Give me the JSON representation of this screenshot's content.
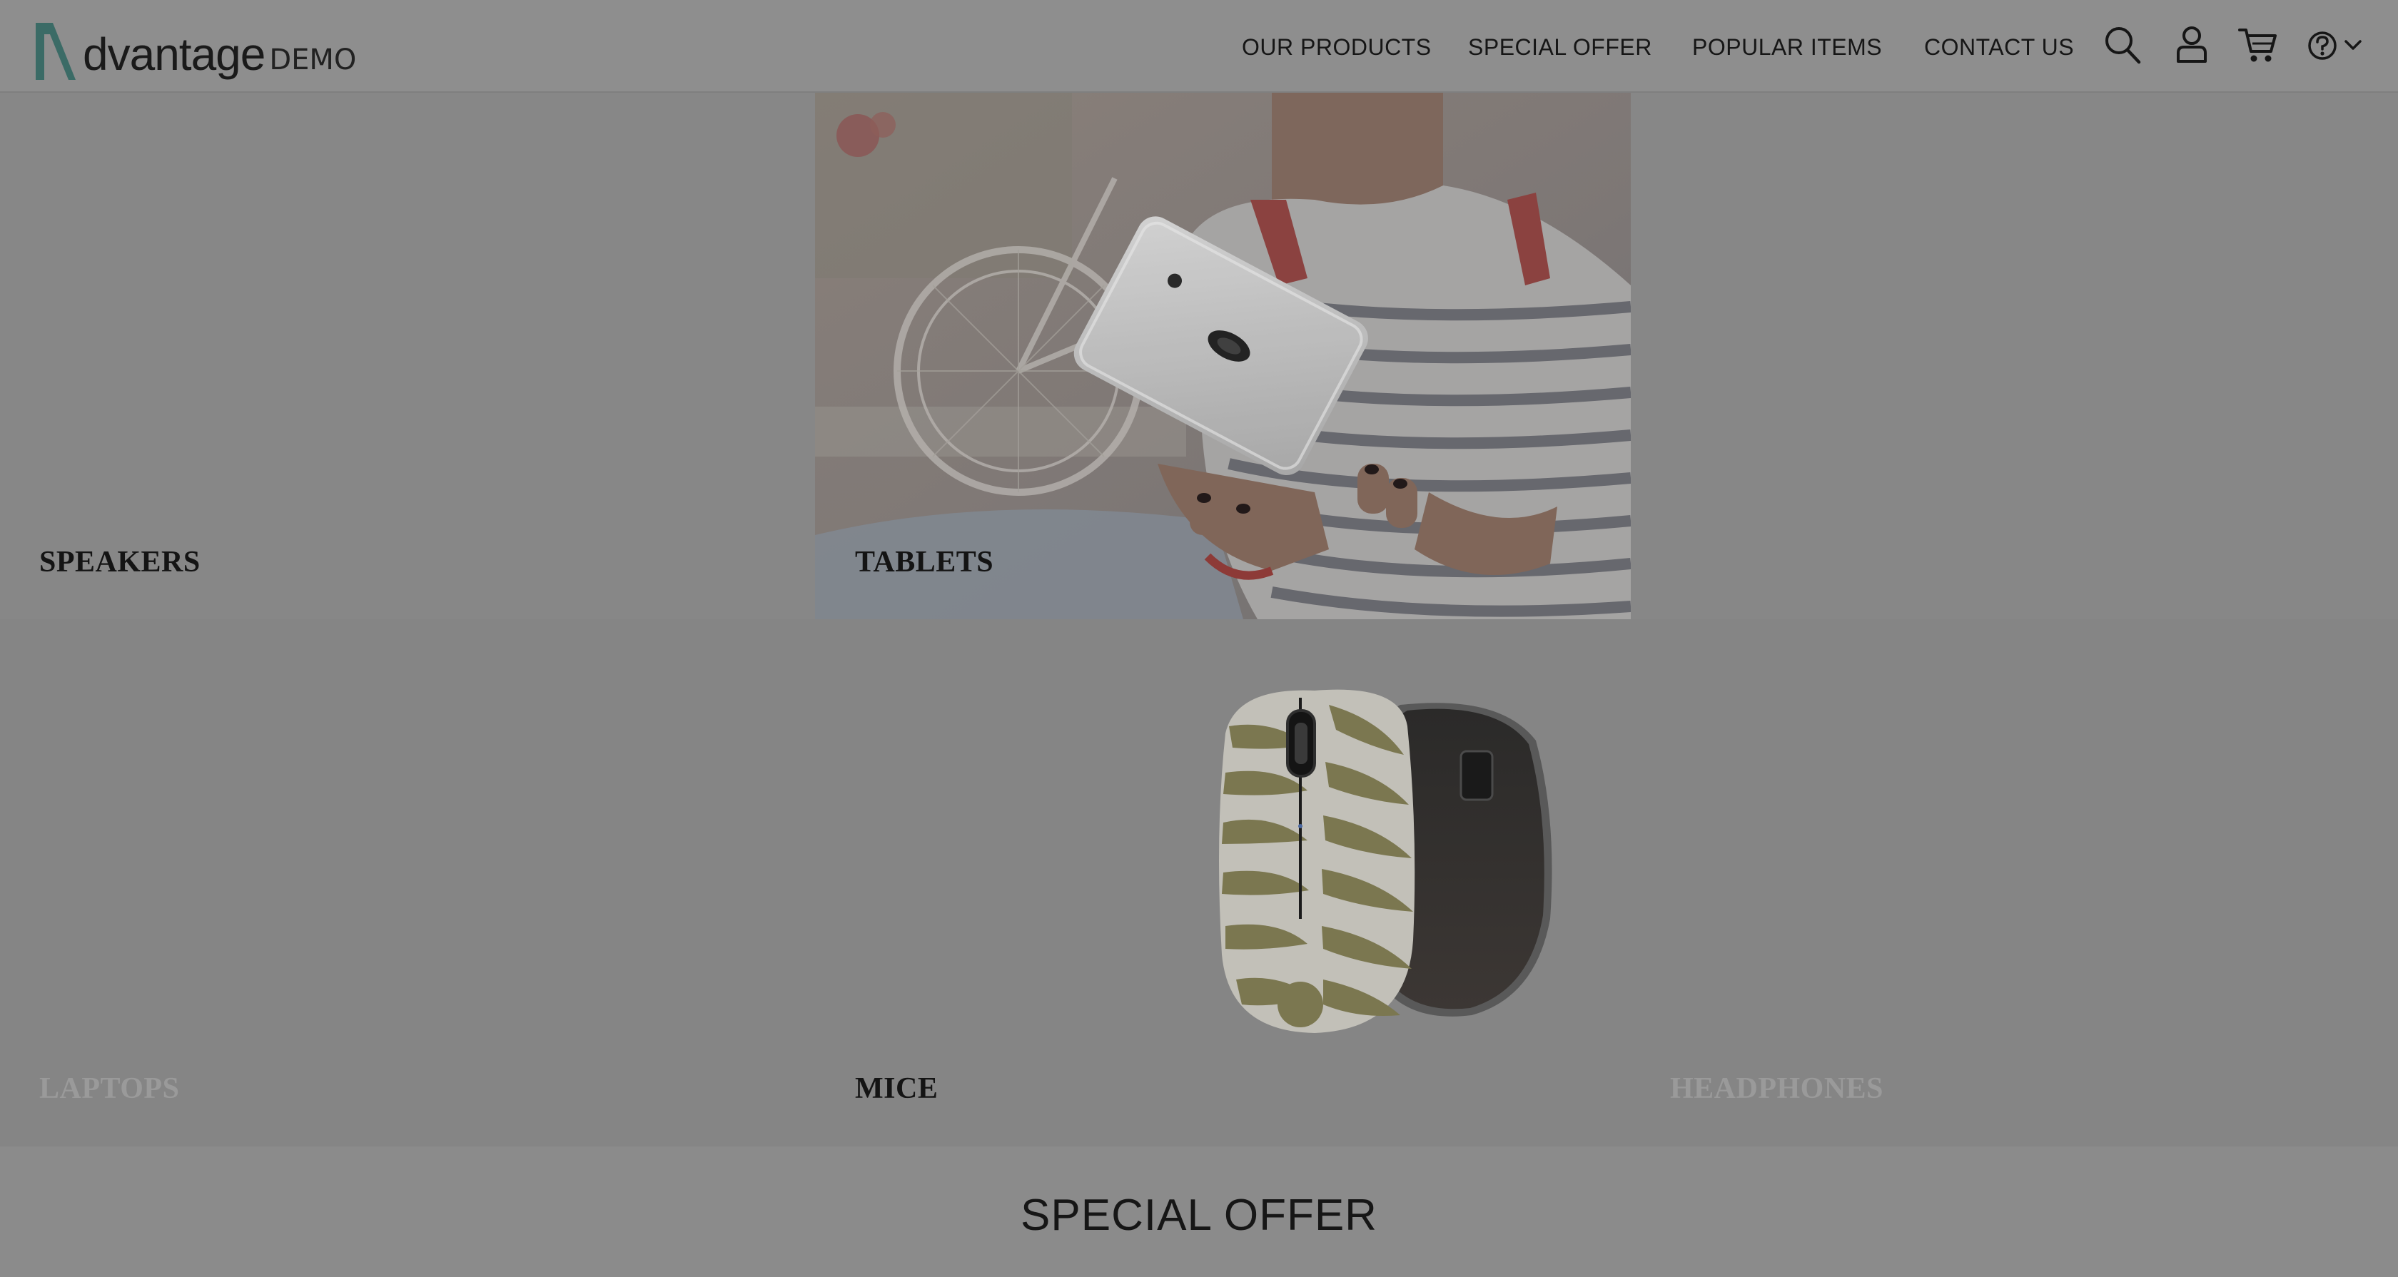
{
  "header": {
    "logo_word": "dvantage",
    "logo_demo": "DEMO",
    "nav": [
      "OUR PRODUCTS",
      "SPECIAL OFFER",
      "POPULAR ITEMS",
      "CONTACT US"
    ],
    "icons": [
      "search-icon",
      "user-icon",
      "cart-icon",
      "help-icon",
      "chevron-down-icon"
    ]
  },
  "categories": {
    "speakers": "SPEAKERS",
    "tablets": "TABLETS",
    "laptops": "LAPTOPS",
    "mice": "MICE",
    "headphones": "HEADPHONES"
  },
  "special_offer": {
    "title": "SPECIAL OFFER"
  },
  "colors": {
    "overlay": "#8a8a8a",
    "logo_accent": "#3b6b66"
  }
}
